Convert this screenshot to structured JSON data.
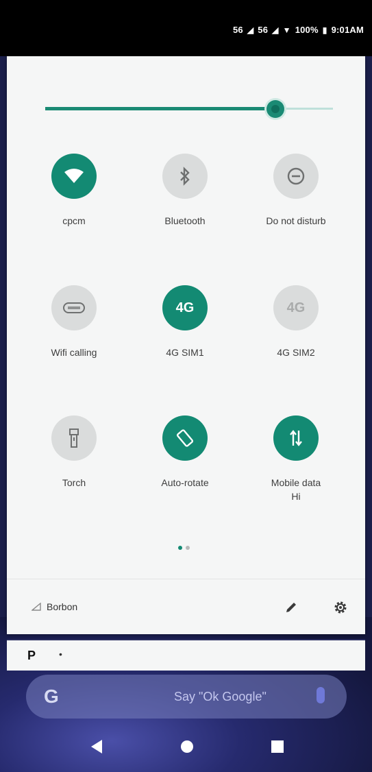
{
  "status_bar": {
    "signal_1": "56",
    "signal_2": "56",
    "battery_percent": "100%",
    "time": "9:01AM"
  },
  "brightness": {
    "level": 0.8
  },
  "tiles": [
    {
      "label": "cpcm",
      "icon": "wifi-icon",
      "state": "on"
    },
    {
      "label": "Bluetooth",
      "icon": "bluetooth-icon",
      "state": "off"
    },
    {
      "label": "Do not disturb",
      "icon": "do-not-disturb-icon",
      "state": "off"
    },
    {
      "label": "Wifi calling",
      "icon": "wifi-calling-icon",
      "state": "off"
    },
    {
      "label": "4G SIM1",
      "icon": "4g-icon",
      "icon_text": "4G",
      "state": "on"
    },
    {
      "label": "4G SIM2",
      "icon": "4g-icon",
      "icon_text": "4G",
      "state": "off"
    },
    {
      "label": "Torch",
      "icon": "torch-icon",
      "state": "off"
    },
    {
      "label": "Auto-rotate",
      "icon": "auto-rotate-icon",
      "state": "on"
    },
    {
      "label": "Mobile data",
      "label_line2": "Hi",
      "icon": "mobile-data-icon",
      "state": "on"
    }
  ],
  "footer": {
    "carrier": "Borbon"
  },
  "notification": {
    "app_letter": "P",
    "bullet": "•"
  },
  "search": {
    "logo": "G",
    "hint": "Say \"Ok Google\""
  },
  "colors": {
    "accent": "#138a73",
    "tile_off": "#dadcdc",
    "panel_bg": "#f5f6f6"
  }
}
